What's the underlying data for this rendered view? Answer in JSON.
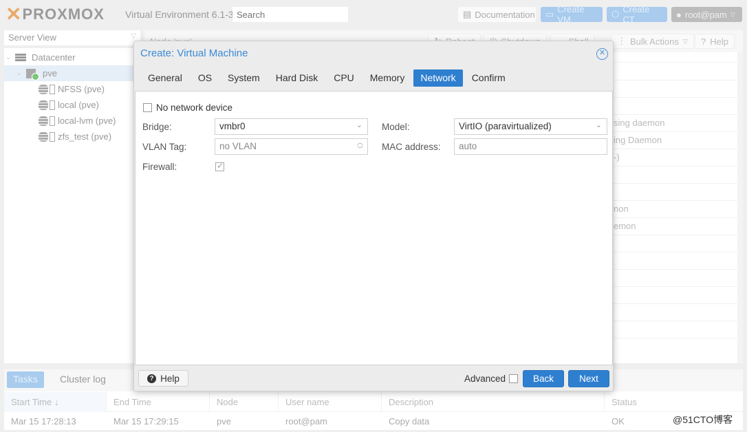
{
  "app": {
    "brand": "PROXMOX",
    "version_label": "Virtual Environment 6.1-3",
    "search_placeholder": "Search",
    "buttons": {
      "documentation": "Documentation",
      "create_vm": "Create VM",
      "create_ct": "Create CT",
      "user": "root@pam"
    }
  },
  "sidebar": {
    "view_select": "Server View",
    "tree": [
      {
        "label": "Datacenter",
        "type": "datacenter"
      },
      {
        "label": "pve",
        "type": "node",
        "selected": true
      },
      {
        "label": "NFSS (pve)",
        "type": "storage"
      },
      {
        "label": "local (pve)",
        "type": "storage"
      },
      {
        "label": "local-lvm (pve)",
        "type": "storage"
      },
      {
        "label": "zfs_test (pve)",
        "type": "storage"
      }
    ]
  },
  "main": {
    "toolbar": {
      "title": "Node 'pve'",
      "reboot": "Reboot",
      "shutdown": "Shutdown",
      "shell": "Shell",
      "bulk_actions": "Bulk Actions",
      "help": "Help"
    },
    "visible_row_fragments": [
      "sing daemon",
      "ing Daemon",
      "-)",
      "non",
      "emon"
    ]
  },
  "dialog": {
    "title": "Create: Virtual Machine",
    "tabs": [
      "General",
      "OS",
      "System",
      "Hard Disk",
      "CPU",
      "Memory",
      "Network",
      "Confirm"
    ],
    "active_tab": "Network",
    "form": {
      "no_network_device": {
        "label": "No network device",
        "checked": false
      },
      "bridge": {
        "label": "Bridge:",
        "value": "vmbr0"
      },
      "vlan_tag": {
        "label": "VLAN Tag:",
        "placeholder": "no VLAN"
      },
      "firewall": {
        "label": "Firewall:",
        "checked": true
      },
      "model": {
        "label": "Model:",
        "value": "VirtIO (paravirtualized)"
      },
      "mac_address": {
        "label": "MAC address:",
        "placeholder": "auto"
      }
    },
    "footer": {
      "help": "Help",
      "advanced": "Advanced",
      "advanced_checked": false,
      "back": "Back",
      "next": "Next"
    }
  },
  "tasks": {
    "tabs": [
      "Tasks",
      "Cluster log"
    ],
    "columns": [
      "Start Time ↓",
      "End Time",
      "Node",
      "User name",
      "Description",
      "Status"
    ],
    "rows": [
      [
        "Mar 15 17:28:13",
        "Mar 15 17:29:15",
        "pve",
        "root@pam",
        "Copy data",
        "OK"
      ]
    ]
  },
  "watermark": "@51CTO博客",
  "colors": {
    "accent": "#2f7fd0",
    "title_blue": "#3a8ad6",
    "brand_orange": "#e57000"
  }
}
